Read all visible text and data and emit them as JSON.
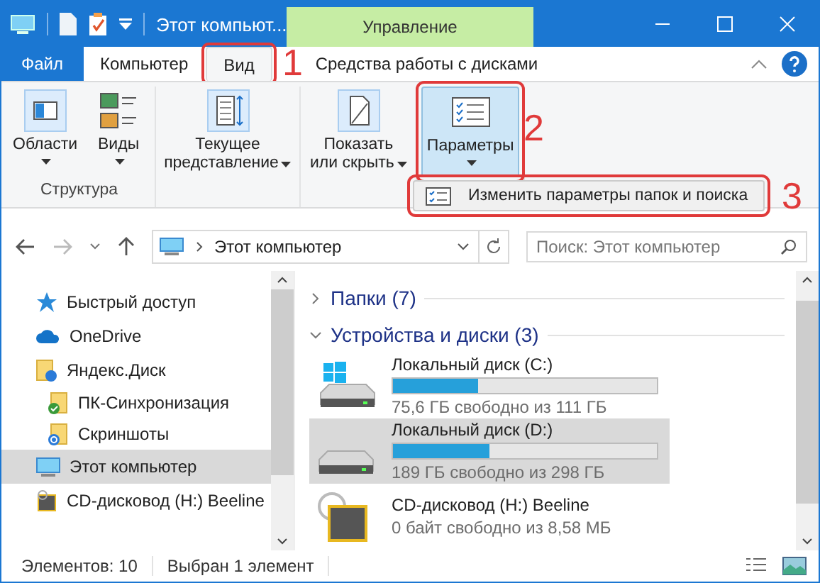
{
  "window": {
    "title": "Этот компьют...",
    "context_tab": "Управление"
  },
  "ribbon_tabs": [
    {
      "label": "Файл",
      "kind": "file",
      "selected": false
    },
    {
      "label": "Компьютер",
      "kind": "tab",
      "selected": false
    },
    {
      "label": "Вид",
      "kind": "tab",
      "selected": true,
      "highlighted": true
    },
    {
      "label": "Средства работы с дисками",
      "kind": "tab",
      "selected": false
    }
  ],
  "ribbon_groups": [
    {
      "label": "Структура",
      "buttons": [
        {
          "kind": "panes",
          "lines": [
            "Области"
          ],
          "selected": false
        },
        {
          "kind": "views",
          "lines": [
            "Виды"
          ],
          "selected": false
        }
      ]
    },
    {
      "buttons": [
        {
          "kind": "current_view",
          "lines": [
            "Текущее",
            "представление"
          ],
          "selected": false
        }
      ]
    },
    {
      "buttons": [
        {
          "kind": "show_hide",
          "lines": [
            "Показать",
            "или скрыть"
          ],
          "selected": false
        }
      ]
    },
    {
      "buttons": [
        {
          "kind": "options",
          "lines": [
            "Параметры"
          ],
          "selected": true,
          "highlighted": true
        }
      ]
    }
  ],
  "popup_menu": {
    "label": "Изменить параметры папок и поиска",
    "highlighted": true
  },
  "annotations": [
    "1",
    "2",
    "3"
  ],
  "address": {
    "path": "Этот компьютер"
  },
  "search": {
    "placeholder": "Поиск: Этот компьютер"
  },
  "navigation": [
    {
      "label": "Быстрый доступ",
      "kind": "star",
      "selected": false
    },
    {
      "label": "OneDrive",
      "kind": "cloud",
      "selected": false
    },
    {
      "label": "Яндекс.Диск",
      "kind": "folder",
      "selected": false,
      "children": [
        {
          "label": "ПК-Синхронизация",
          "kind": "folder_ok",
          "selected": false
        },
        {
          "label": "Скриншоты",
          "kind": "folder_sync",
          "selected": false
        }
      ]
    },
    {
      "label": "Этот компьютер",
      "kind": "computer",
      "selected": true
    },
    {
      "label": "CD-дисковод (H:) Beeline",
      "kind": "cd",
      "selected": false
    }
  ],
  "groups": [
    {
      "label": "Папки (7)",
      "expanded": false
    },
    {
      "label": "Устройства и диски (3)",
      "expanded": true
    }
  ],
  "drives": [
    {
      "name": "Локальный диск (C:)",
      "kind": "system",
      "level": 0.32,
      "free": "75,6 ГБ свободно из 111 ГБ",
      "selected": false
    },
    {
      "name": "Локальный диск (D:)",
      "kind": "disk",
      "level": 0.366,
      "free": "189 ГБ свободно из 298 ГБ",
      "selected": true
    },
    {
      "name": "CD-дисковод (H:) Beeline",
      "kind": "cd",
      "free": "0 байт свободно из 8,58 МБ",
      "selected": false
    }
  ],
  "status_bar": {
    "items": "Элементов: 10",
    "selected": "Выбран 1 элемент"
  }
}
